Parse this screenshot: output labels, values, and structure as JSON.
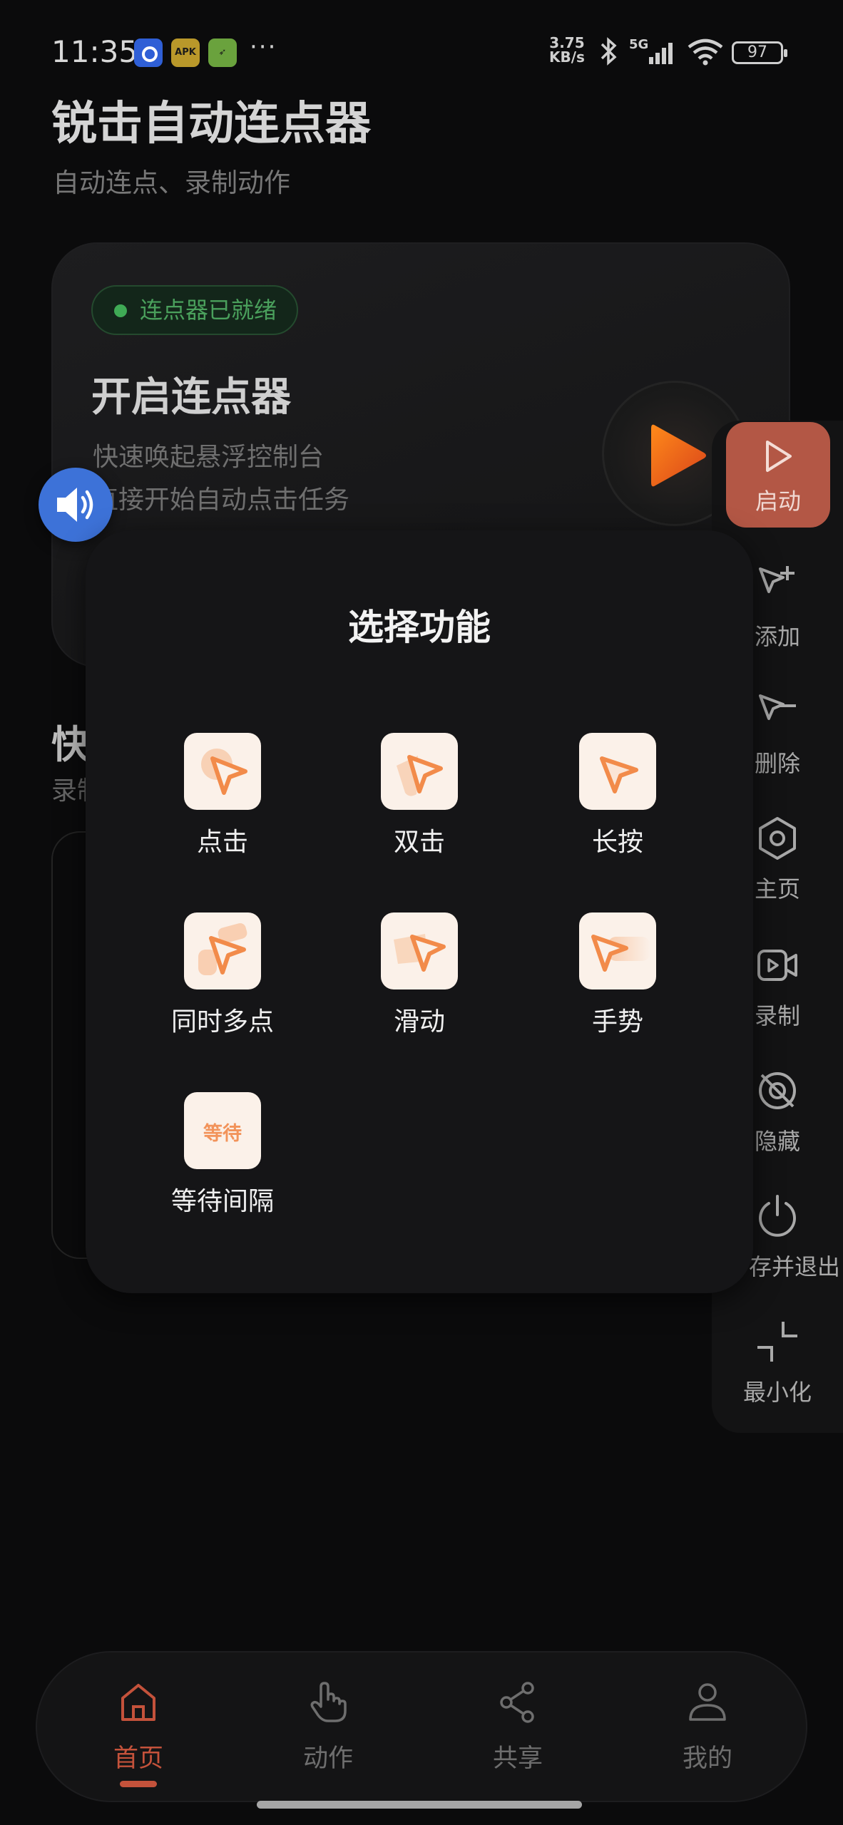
{
  "status_bar": {
    "time": "11:35",
    "notification_icons": [
      "browser-icon",
      "apk-icon",
      "app-icon"
    ],
    "more": "···",
    "net_speed_value": "3.75",
    "net_speed_unit": "KB/s",
    "network": "5G",
    "battery": "97"
  },
  "header": {
    "title": "锐击自动连点器",
    "subtitle": "自动连点、录制动作"
  },
  "main_card": {
    "badge": "连点器已就绪",
    "title": "开启连点器",
    "line1": "快速唤起悬浮控制台",
    "line2": "直接开始自动点击任务",
    "accent": "#e85d1a"
  },
  "quick_section": {
    "title_visible": "快",
    "subtitle_visible": "录制"
  },
  "float_panel": {
    "start": "启动",
    "items": [
      "添加",
      "删除",
      "主页",
      "录制",
      "隐藏",
      "存并退出",
      "最小化"
    ]
  },
  "dialog": {
    "title": "选择功能",
    "functions": [
      "点击",
      "双击",
      "长按",
      "同时多点",
      "滑动",
      "手势",
      "等待间隔"
    ],
    "wait_icon_text": "等待"
  },
  "bottom_nav": {
    "items": [
      "首页",
      "动作",
      "共享",
      "我的"
    ],
    "active": "首页",
    "active_color": "#c4523b"
  }
}
